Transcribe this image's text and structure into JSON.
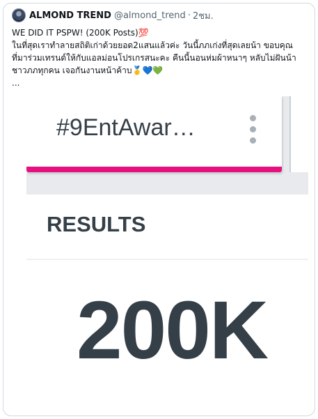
{
  "tweet": {
    "display_name": "ALMOND TREND",
    "handle": "@almond_trend",
    "separator": "·",
    "time": "2ชม.",
    "lines": [
      "WE DID IT PSPW! (200K Posts)💯",
      "ในที่สุดเราทำลายสถิติเก่าด้วยยอด2แสนแล้วค่ะ วันนี้ภภเก่งที่สุดเลยน้า ขอบคุณ",
      "ที่มาร่วมเทรนด์ให้กับแอลม่อนโปรเกรสนะคะ คืนนี้นอนห่มผ้าหนาๆ หลับไม่ฝันน้า",
      "ชาวภภทุกคน เจอกันงานหน้าค้าบ🥇💙💚",
      "..."
    ]
  },
  "media": {
    "hashtag": "#9EntAwar…",
    "results_label": "RESULTS",
    "result_value": "200K",
    "accent_color": "#e6107f",
    "text_color": "#353f48",
    "menu_icon": "kebab-menu-icon"
  }
}
